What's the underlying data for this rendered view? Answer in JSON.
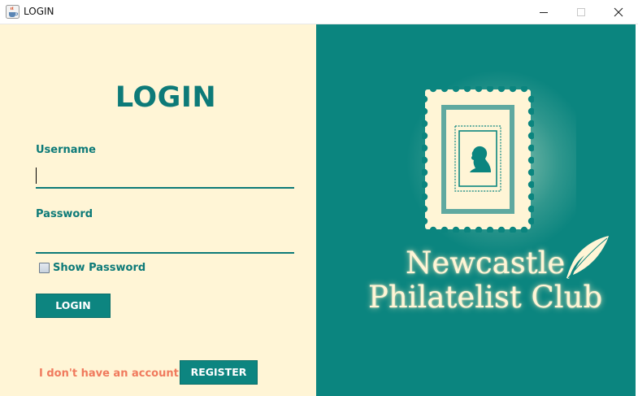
{
  "window": {
    "title": "LOGIN",
    "icon": "java-cup-icon",
    "controls": [
      "minimize-icon",
      "maximize-icon",
      "close-icon"
    ]
  },
  "form": {
    "heading": "LOGIN",
    "username_label": "Username",
    "username_value": "",
    "password_label": "Password",
    "password_value": "",
    "show_password_label": "Show Password",
    "show_password_checked": false,
    "login_button": "LOGIN",
    "no_account_text": "I don't have an account",
    "register_button": "REGISTER"
  },
  "brand": {
    "line1": "Newcastle",
    "line2": "Philatelist Club",
    "logo_icon": "postage-stamp-icon",
    "decoration_icon": "quill-feather-icon"
  },
  "colors": {
    "left_background": "#fff5d6",
    "accent_teal": "#0d7a78",
    "button_teal": "#0d8580",
    "right_background": "#0b857f",
    "no_account_text": "#f07a5d",
    "brand_text": "#fff5d6"
  }
}
